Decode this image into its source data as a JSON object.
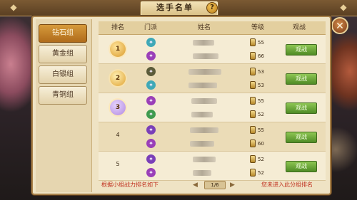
{
  "header": {
    "title": "选手名单",
    "help_icon": "question-icon",
    "close_icon": "close-icon"
  },
  "sidebar": {
    "tabs": [
      {
        "label": "钻石组",
        "active": true
      },
      {
        "label": "黄金组",
        "active": false
      },
      {
        "label": "白银组",
        "active": false
      },
      {
        "label": "青铜组",
        "active": false
      }
    ]
  },
  "table": {
    "columns": [
      "排名",
      "门派",
      "姓名",
      "等级",
      "观战"
    ],
    "rows": [
      {
        "rank": "1",
        "medal": "gold-medal-icon",
        "players": [
          {
            "level": "55"
          },
          {
            "level": "66"
          }
        ],
        "watch_label": "观战"
      },
      {
        "rank": "2",
        "medal": "silver-medal-icon",
        "players": [
          {
            "level": "53"
          },
          {
            "level": "53"
          }
        ],
        "watch_label": "观战"
      },
      {
        "rank": "3",
        "medal": "bronze-medal-icon",
        "players": [
          {
            "level": "55"
          },
          {
            "level": "52"
          }
        ],
        "watch_label": "观战"
      },
      {
        "rank": "4",
        "medal": "",
        "players": [
          {
            "level": "55"
          },
          {
            "level": "60"
          }
        ],
        "watch_label": "观战"
      },
      {
        "rank": "5",
        "medal": "",
        "players": [
          {
            "level": "52"
          },
          {
            "level": "52"
          }
        ],
        "watch_label": "观战"
      }
    ]
  },
  "footer": {
    "note_left": "根据小组战力排名如下",
    "page": "1/6",
    "note_right": "您未进入此分组排名"
  },
  "colors": {
    "accent_red": "#c0301e",
    "watch_green": "#5e9a2c",
    "active_tab": "#c07a24"
  }
}
